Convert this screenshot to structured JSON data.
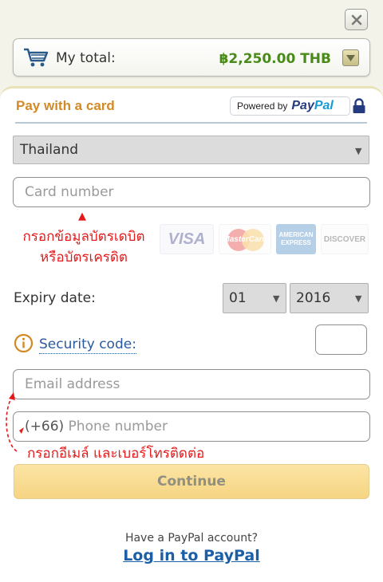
{
  "header": {
    "total_label": "My total:",
    "total_amount": "฿2,250.00 THB"
  },
  "card_form": {
    "title": "Pay with a card",
    "powered_by": "Powered by",
    "paypal_pay": "Pay",
    "paypal_pal": "Pal",
    "country_value": "Thailand",
    "card_number_placeholder": "Card number",
    "card_note_line1": "กรอกข้อมูลบัตรเดบิต",
    "card_note_line2": "หรือบัตรเครดิต",
    "card_logos": [
      "VISA",
      "MasterCard",
      "AMERICAN EXPRESS",
      "DISCOVER"
    ],
    "expiry_label": "Expiry date:",
    "expiry_month": "01",
    "expiry_year": "2016",
    "security_label": "Security code:",
    "email_placeholder": "Email address",
    "phone_prefix": "(+66)",
    "phone_placeholder": "Phone number",
    "contact_note": "กรอกอีเมล์ และเบอร์โทรติดต่อ",
    "continue_label": "Continue"
  },
  "footer": {
    "have_account": "Have a PayPal account?",
    "login_label": "Log in to PayPal"
  },
  "colors": {
    "accent_orange": "#d28a26",
    "total_green": "#4a8a1c",
    "annotation_red": "#e41a1a",
    "link_blue": "#1c5fa6",
    "button_yellow": "#f6d583"
  }
}
